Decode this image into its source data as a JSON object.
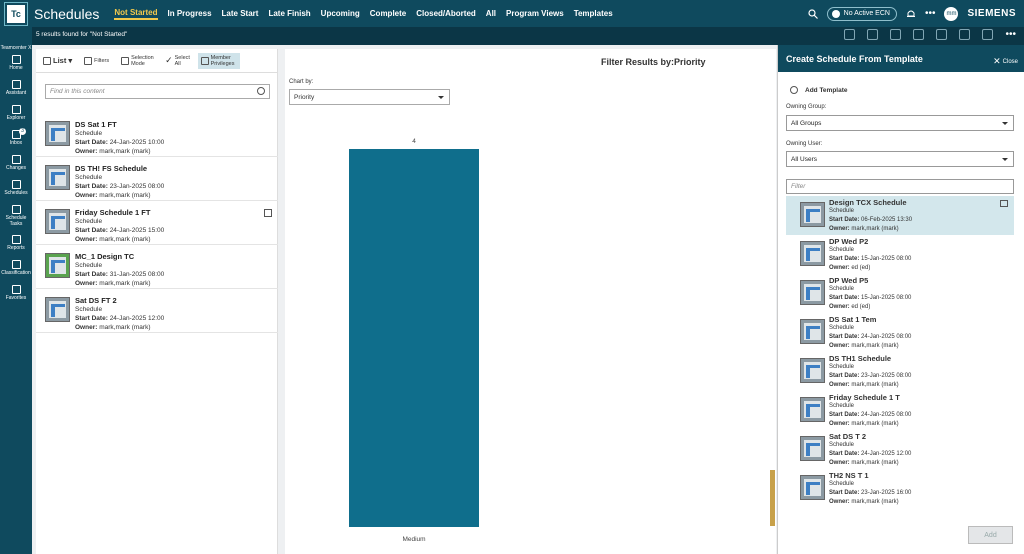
{
  "app": {
    "logo_text": "Tc",
    "title": "Schedules",
    "tabs": [
      "Not Started",
      "In Progress",
      "Late Start",
      "Late Finish",
      "Upcoming",
      "Complete",
      "Closed/Aborted",
      "All",
      "Program Views",
      "Templates"
    ],
    "active_tab": "Not Started",
    "ecn_label": "No Active ECN",
    "avatar_initials": "mm",
    "brand": "SIEMENS",
    "accent_color": "#0f4a5e",
    "active_tab_color": "#f2c94c"
  },
  "subbar": {
    "results_text": "5 results found for \"Not Started\""
  },
  "rail": {
    "items": [
      "Teamcenter X",
      "Home",
      "Assistant",
      "Explorer",
      "Inbox",
      "Changes",
      "Schedules",
      "Schedule Tasks",
      "Reports",
      "Classification",
      "Favorites"
    ],
    "inbox_badge": "3"
  },
  "list_panel": {
    "toolbar": {
      "list": "List",
      "filters": "Filters",
      "selection_mode": "Selection Mode",
      "select_all": "Select All",
      "member_privileges": "Member Privileges"
    },
    "search_placeholder": "Find in this content",
    "field_labels": {
      "start": "Start Date:",
      "owner": "Owner:"
    },
    "items": [
      {
        "title": "DS Sat 1 FT",
        "type": "Schedule",
        "start": "24-Jan-2025 10:00",
        "owner": "mark,mark (mark)"
      },
      {
        "title": "DS TH! FS Schedule",
        "type": "Schedule",
        "start": "23-Jan-2025 08:00",
        "owner": "mark,mark (mark)"
      },
      {
        "title": "Friday Schedule 1 FT",
        "type": "Schedule",
        "start": "24-Jan-2025 15:00",
        "owner": "mark,mark (mark)"
      },
      {
        "title": "MC_1 Design TC",
        "type": "Schedule",
        "start": "31-Jan-2025 08:00",
        "owner": "mark,mark (mark)"
      },
      {
        "title": "Sat DS FT 2",
        "type": "Schedule",
        "start": "24-Jan-2025 12:00",
        "owner": "mark,mark (mark)"
      }
    ]
  },
  "chart_panel": {
    "heading": "Filter Results by:Priority",
    "chart_by_label": "Chart by:",
    "chart_by_value": "Priority"
  },
  "chart_data": {
    "type": "bar",
    "categories": [
      "Medium"
    ],
    "values": [
      4
    ],
    "title": "Filter Results by:Priority",
    "xlabel": "",
    "ylabel": "",
    "ylim": [
      0,
      4
    ],
    "bar_color": "#0f6e8c",
    "grid": false
  },
  "right_panel": {
    "title": "Create Schedule From Template",
    "close": "Close",
    "add_template": "Add Template",
    "owning_group_label": "Owning Group:",
    "owning_group_value": "All Groups",
    "owning_user_label": "Owning User:",
    "owning_user_value": "All Users",
    "filter_placeholder": "Filter",
    "add_button": "Add",
    "field_labels": {
      "start": "Start Date:",
      "owner": "Owner:"
    },
    "templates": [
      {
        "title": "Design TCX Schedule",
        "type": "Schedule",
        "start": "06-Feb-2025 13:30",
        "owner": "mark,mark (mark)",
        "selected": true
      },
      {
        "title": "DP Wed P2",
        "type": "Schedule",
        "start": "15-Jan-2025 08:00",
        "owner": "ed (ed)"
      },
      {
        "title": "DP Wed P5",
        "type": "Schedule",
        "start": "15-Jan-2025 08:00",
        "owner": "ed (ed)"
      },
      {
        "title": "DS Sat 1 Tem",
        "type": "Schedule",
        "start": "24-Jan-2025 08:00",
        "owner": "mark,mark (mark)"
      },
      {
        "title": "DS TH1 Schedule",
        "type": "Schedule",
        "start": "23-Jan-2025 08:00",
        "owner": "mark,mark (mark)"
      },
      {
        "title": "Friday Schedule 1 T",
        "type": "Schedule",
        "start": "24-Jan-2025 08:00",
        "owner": "mark,mark (mark)"
      },
      {
        "title": "Sat DS T 2",
        "type": "Schedule",
        "start": "24-Jan-2025 12:00",
        "owner": "mark,mark (mark)"
      },
      {
        "title": "TH2 NS T 1",
        "type": "Schedule",
        "start": "23-Jan-2025 16:00",
        "owner": "mark,mark (mark)"
      }
    ]
  }
}
